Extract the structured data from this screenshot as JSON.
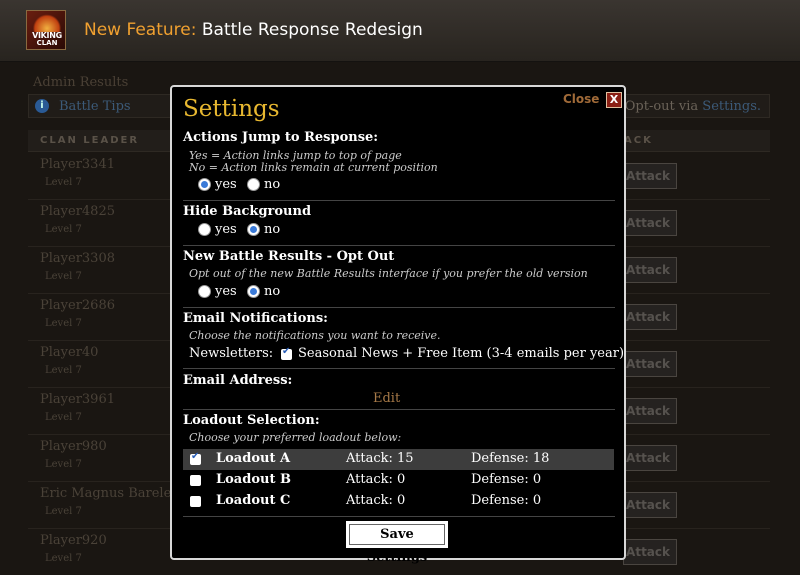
{
  "header": {
    "logo_line1": "VIKING",
    "logo_line2": "CLAN",
    "accent": "New Feature:",
    "title": "Battle Response Redesign"
  },
  "background": {
    "admin_results": "Admin Results",
    "tips_label": "Battle Tips",
    "tips_right_text": "Opt-out via",
    "tips_right_link": "Settings.",
    "col_left": "CLAN LEADER",
    "col_right": "ACK",
    "attack_label": "Attack",
    "rows": [
      {
        "name": "Player3341",
        "level": "Level 7"
      },
      {
        "name": "Player4825",
        "level": "Level 7"
      },
      {
        "name": "Player3308",
        "level": "Level 7"
      },
      {
        "name": "Player2686",
        "level": "Level 7"
      },
      {
        "name": "Player40",
        "level": "Level 7"
      },
      {
        "name": "Player3961",
        "level": "Level 7"
      },
      {
        "name": "Player980",
        "level": "Level 7"
      },
      {
        "name": "Eric Magnus Barele",
        "level": "Level 7"
      },
      {
        "name": "Player920",
        "level": "Level 7"
      }
    ]
  },
  "modal": {
    "title": "Settings",
    "close_label": "Close",
    "close_x": "X",
    "actions_jump": {
      "title": "Actions Jump to Response:",
      "desc1": "Yes = Action links jump to top of page",
      "desc2": "No = Action links remain at current position",
      "yes": "yes",
      "no": "no",
      "selected": "yes"
    },
    "hide_background": {
      "title": "Hide Background",
      "yes": "yes",
      "no": "no",
      "selected": "no"
    },
    "opt_out": {
      "title": "New Battle Results - Opt Out",
      "desc": "Opt out of the new Battle Results interface if you prefer the old version",
      "yes": "yes",
      "no": "no",
      "selected": "no"
    },
    "email_notifications": {
      "title": "Email Notifications:",
      "desc": "Choose the notifications you want to receive.",
      "newsletters_label": "Newsletters:",
      "newsletters_option": "Seasonal News + Free Item (3-4 emails per year)",
      "newsletters_checked": true
    },
    "email_address": {
      "title": "Email Address:",
      "edit": "Edit"
    },
    "loadout": {
      "title": "Loadout Selection:",
      "desc": "Choose your preferred loadout below:",
      "items": [
        {
          "name": "Loadout A",
          "attack": "Attack: 15",
          "defense": "Defense: 18",
          "checked": true
        },
        {
          "name": "Loadout B",
          "attack": "Attack: 0",
          "defense": "Defense: 0",
          "checked": false
        },
        {
          "name": "Loadout C",
          "attack": "Attack: 0",
          "defense": "Defense: 0",
          "checked": false
        }
      ]
    },
    "save_label": "Save Settings"
  }
}
